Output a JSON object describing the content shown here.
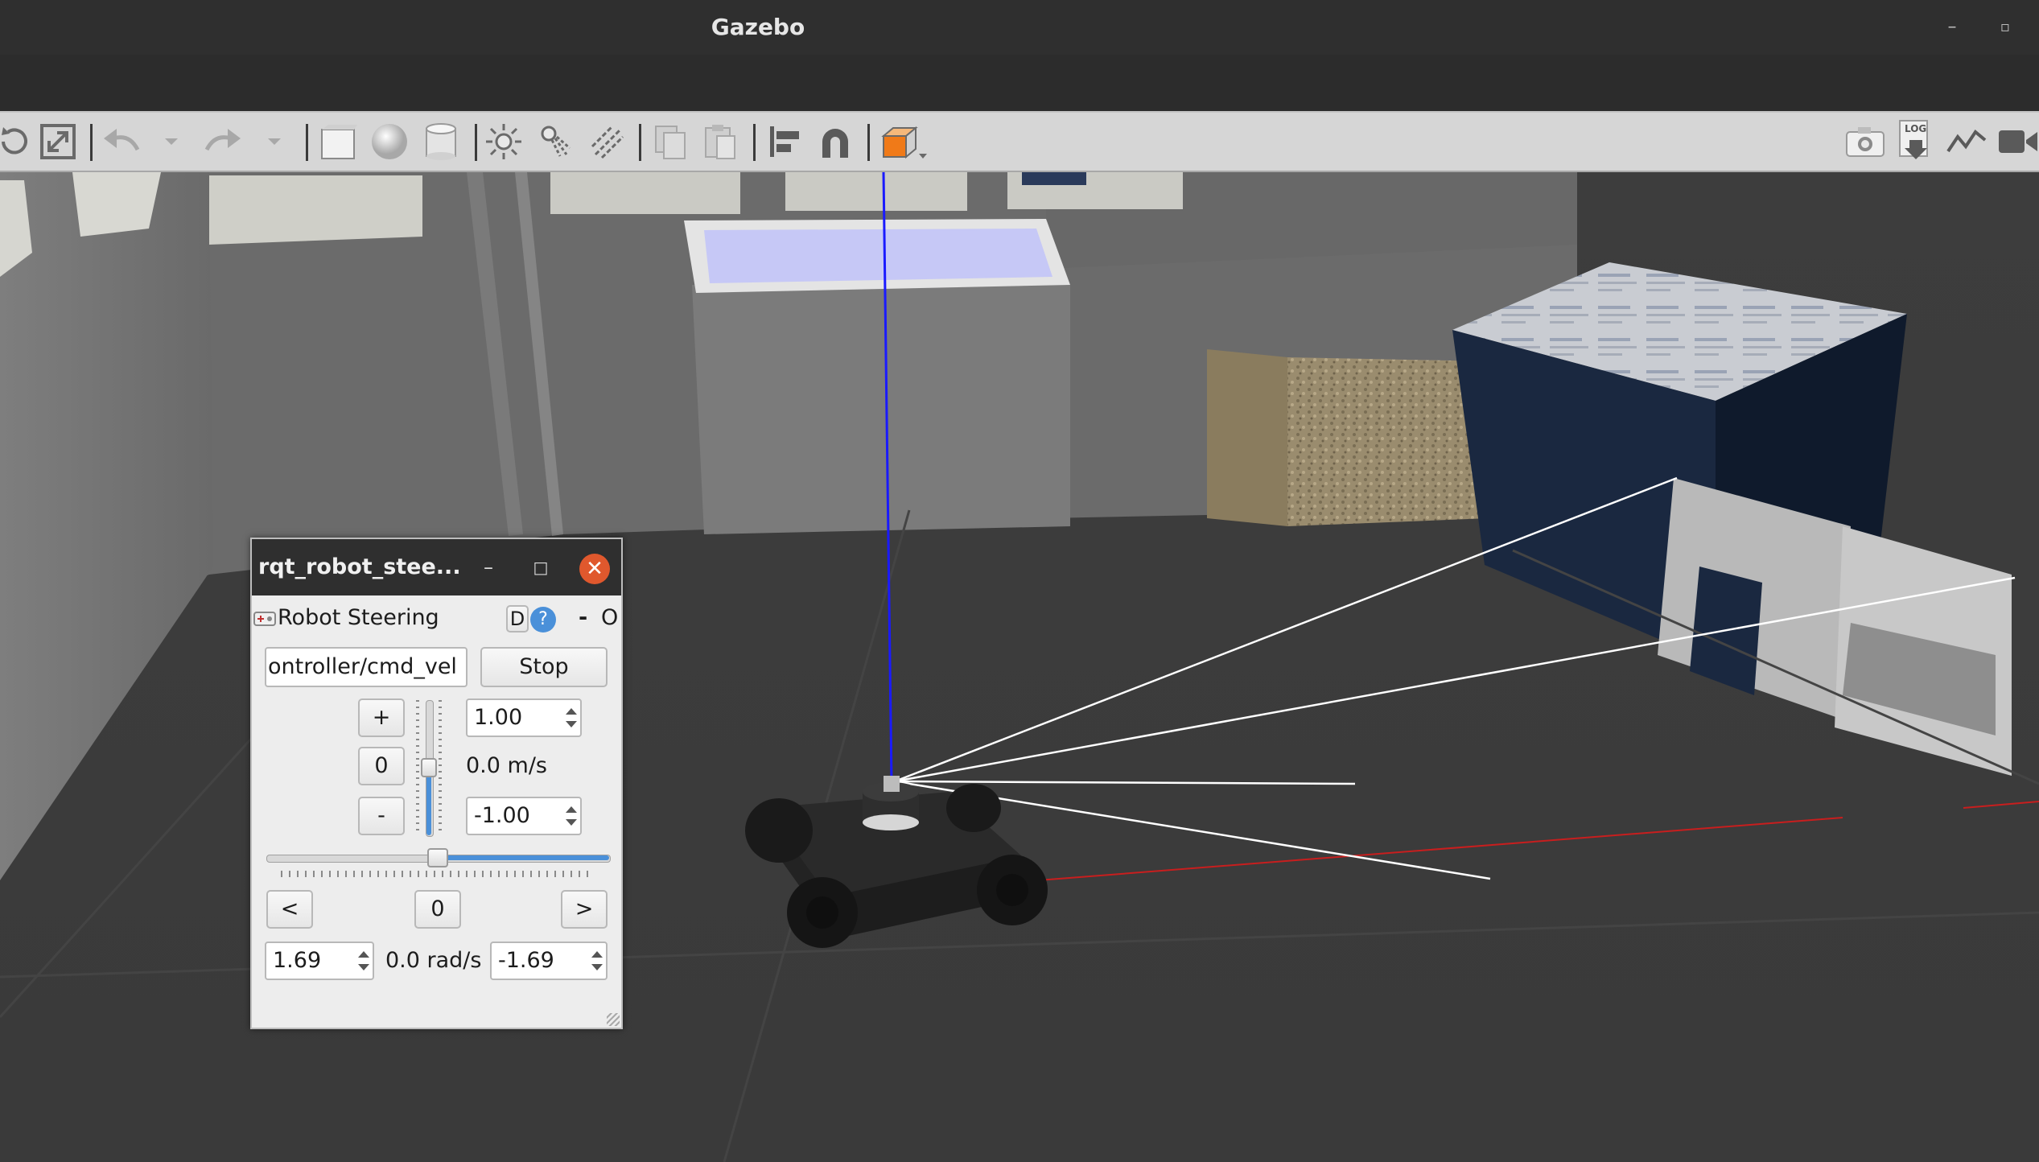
{
  "window": {
    "title": "Gazebo"
  },
  "colors": {
    "titlebar": "#2f2f2f",
    "toolbar": "#d6d6d6",
    "close_button": "#e0582d",
    "slider_accent": "#4a90d9",
    "ground": "#3c3c3c",
    "laser_ray": "#ffffff",
    "z_axis": "#1a1aff",
    "x_axis": "#c81e1e"
  },
  "toolbar": {
    "left_tools": [
      "rotate-icon",
      "scale-icon",
      "undo-icon",
      "undo-dropdown-icon",
      "redo-icon",
      "redo-dropdown-icon",
      "box-icon",
      "sphere-icon",
      "cylinder-icon",
      "point-light-icon",
      "spot-light-icon",
      "directional-light-icon",
      "copy-icon",
      "paste-icon",
      "align-icon",
      "magnet-icon",
      "view-angle-icon"
    ],
    "right_tools": [
      "screenshot-icon",
      "log-icon",
      "plot-icon",
      "video-record-icon"
    ],
    "log_label": "LOG"
  },
  "steering": {
    "window_title": "rqt_robot_stee...",
    "plugin_title": "Robot Steering",
    "d_label": "D",
    "help_label": "?",
    "dash_label": "-",
    "o_label": "O",
    "topic_value": "ontroller/cmd_vel",
    "stop_label": "Stop",
    "plus_label": "+",
    "zero_label": "0",
    "minus_label": "-",
    "linear_max": "1.00",
    "linear_min": "-1.00",
    "linear_readout": "0.0 m/s",
    "left_label": "<",
    "right_label": ">",
    "angular_zero": "0",
    "angular_left": "1.69",
    "angular_right": "-1.69",
    "angular_readout": "0.0 rad/s",
    "linear_velocity": 0.0,
    "angular_velocity": 0.0
  }
}
